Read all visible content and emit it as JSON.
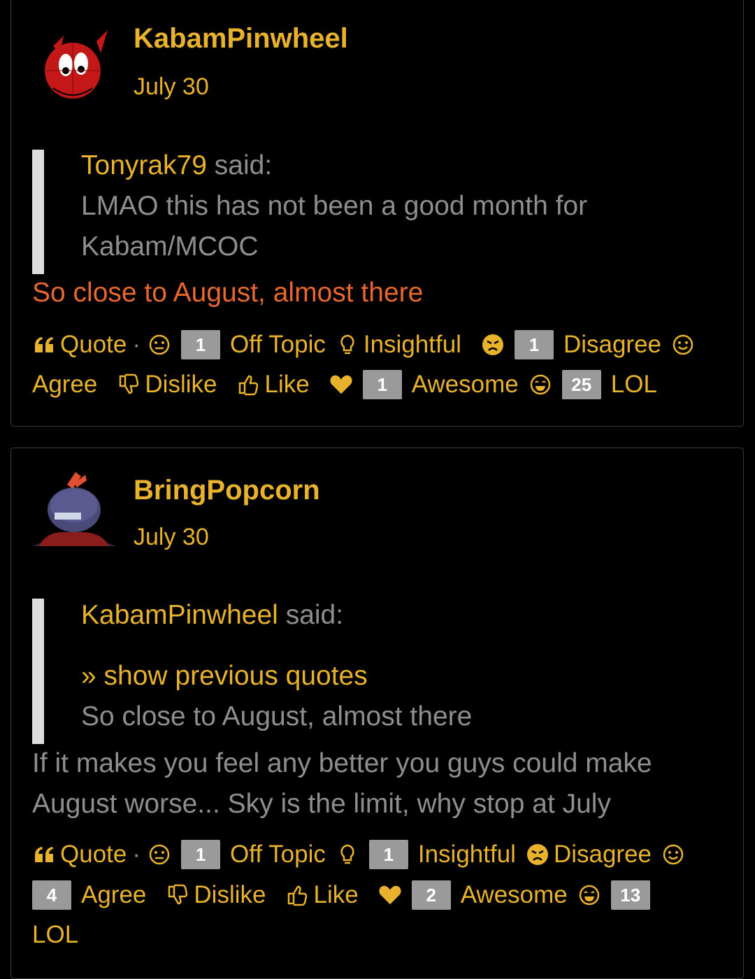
{
  "posts": [
    {
      "username": "KabamPinwheel",
      "date": "July 30",
      "quote": {
        "author": "Tonyrak79",
        "said": "said:",
        "lines": [
          "LMAO this has not been a good month for",
          "Kabam/MCOC"
        ]
      },
      "body_lines": [
        "So close to August, almost there"
      ],
      "reactions": {
        "quote": "Quote",
        "off_topic": {
          "label": "Off Topic",
          "count": "1"
        },
        "insightful": {
          "label": "Insightful",
          "count": ""
        },
        "disagree": {
          "label": "Disagree",
          "count": "1"
        },
        "agree": {
          "label": "Agree",
          "count": ""
        },
        "dislike": {
          "label": "Dislike"
        },
        "like": {
          "label": "Like"
        },
        "awesome": {
          "label": "Awesome",
          "count": "1"
        },
        "lol": {
          "label": "LOL",
          "count": "25"
        }
      }
    },
    {
      "username": "BringPopcorn",
      "date": "July 30",
      "quote": {
        "author": "KabamPinwheel",
        "said": "said:",
        "show_previous": "» show previous quotes",
        "lines": [
          "So close to August, almost there"
        ]
      },
      "body_lines": [
        "If it makes you feel any better you guys could make",
        "August worse... Sky is the limit, why stop at July"
      ],
      "reactions": {
        "quote": "Quote",
        "off_topic": {
          "label": "Off Topic",
          "count": "1"
        },
        "insightful": {
          "label": "Insightful",
          "count": "1"
        },
        "disagree": {
          "label": "Disagree",
          "count": ""
        },
        "agree": {
          "label": "Agree",
          "count": "4"
        },
        "dislike": {
          "label": "Dislike"
        },
        "like": {
          "label": "Like"
        },
        "awesome": {
          "label": "Awesome",
          "count": "2"
        },
        "lol": {
          "label": "LOL",
          "count": "13"
        }
      }
    }
  ],
  "colors": {
    "accent": "#e9b22c",
    "highlight": "#e8672f",
    "text": "#8e8e8e",
    "badge": "#9a9a9a"
  }
}
